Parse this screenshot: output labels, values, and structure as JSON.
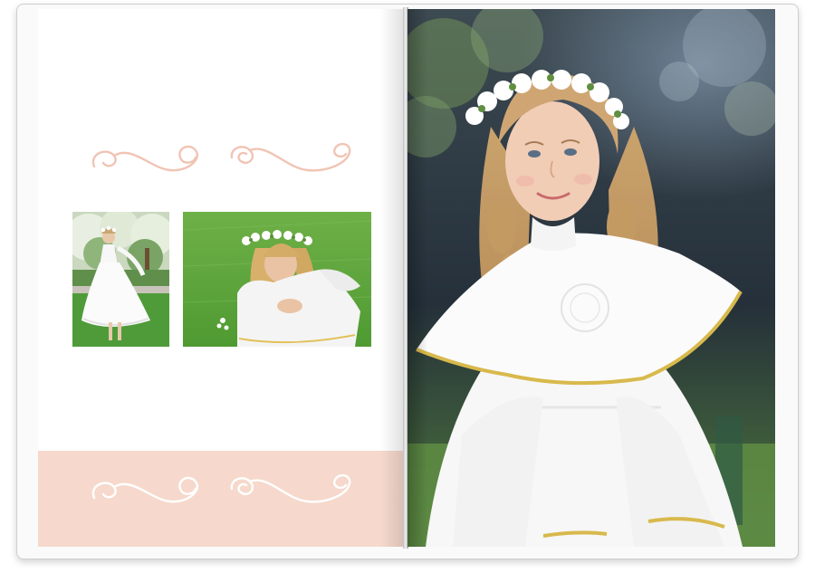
{
  "book": {
    "accent_color": "#f6d9cc",
    "flourish_color": "#f0c4b4",
    "pages": {
      "left": {
        "ornaments": [
          "flourish-ornament-top",
          "flourish-ornament-bottom"
        ],
        "photos": [
          "girl-in-white-dress-in-park-photo",
          "girl-kneeling-on-grass-photo"
        ]
      },
      "right": {
        "photos": [
          "girl-with-flower-crown-portrait-photo"
        ]
      }
    }
  }
}
